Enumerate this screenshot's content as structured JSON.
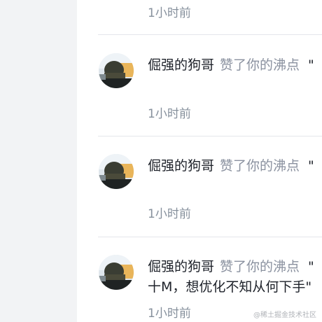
{
  "feed": {
    "top_time": "1小时前",
    "notifications": [
      {
        "user": "倔强的狗哥",
        "action": "赞了你的沸点",
        "quote_mark": "\"",
        "snippet": "",
        "time": "1小时前"
      },
      {
        "user": "倔强的狗哥",
        "action": "赞了你的沸点",
        "quote_mark": "\"",
        "snippet": "",
        "time": "1小时前"
      },
      {
        "user": "倔强的狗哥",
        "action": "赞了你的沸点",
        "quote_mark": "\"",
        "snippet": "十M，想优化不知从何下手\"",
        "time": "1小时前"
      }
    ]
  },
  "watermark": "@稀土掘金技术社区",
  "colors": {
    "sidebar_bg": "#f2f3f5",
    "time_text": "#86909c",
    "action_text": "#8a919f",
    "primary_text": "#1d2129",
    "divider": "#e4e6eb"
  }
}
